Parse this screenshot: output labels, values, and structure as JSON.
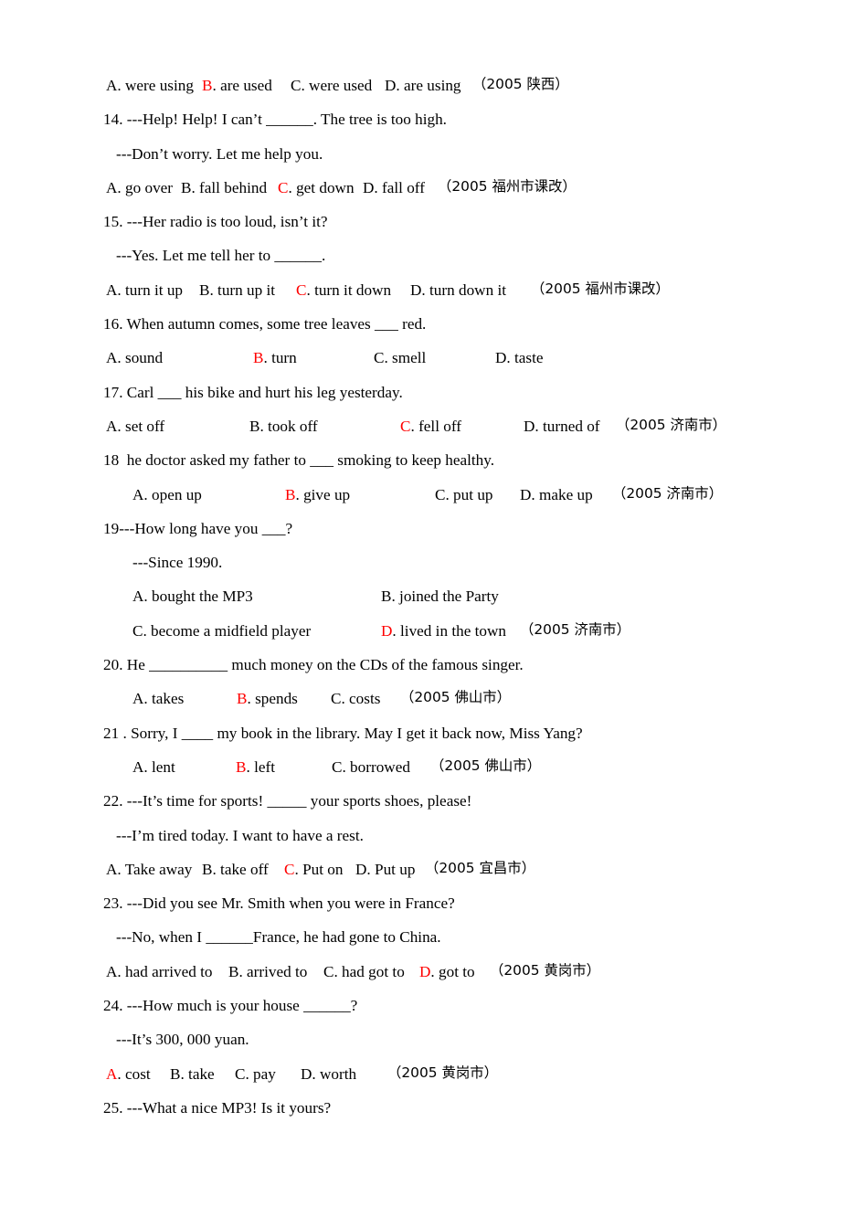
{
  "document": {
    "type": "english-grammar-multiple-choice-worksheet",
    "answer_color": "#ff0000",
    "text_color": "#000000",
    "background_color": "#ffffff"
  },
  "lines": {
    "q13_options": {
      "a": "A. were using",
      "b_letter": "B",
      "b_rest": ". are used",
      "c": "C. were used",
      "d": "D. are using",
      "source": "（2005 陕西）"
    },
    "q14": {
      "stem": "14. ---Help! Help! I can’t ______. The tree is too high.",
      "reply": "---Don’t worry. Let me help you.",
      "a": "A. go over",
      "b": "B. fall behind",
      "c_letter": "C",
      "c_rest": ". get down",
      "d": "D. fall off",
      "source": "（2005 福州市课改）"
    },
    "q15": {
      "stem": "15. ---Her radio is too loud, isn’t it?",
      "reply": "---Yes. Let me tell her to ______.",
      "a": "A. turn it up",
      "b": "B. turn up it",
      "c_letter": "C",
      "c_rest": ". turn it down",
      "d": "D. turn down it",
      "source": "（2005 福州市课改）"
    },
    "q16": {
      "stem": "16. When autumn comes, some tree leaves ___ red.",
      "a": "A. sound",
      "b_letter": "B",
      "b_rest": ". turn",
      "c": "C. smell",
      "d": "D. taste"
    },
    "q17": {
      "stem": "17. Carl ___ his bike and hurt his leg yesterday.",
      "a": "A. set off",
      "b": "B. took off",
      "c_letter": "C",
      "c_rest": ". fell off",
      "d": "D. turned of",
      "source": "（2005 济南市）"
    },
    "q18": {
      "stem": "18  he doctor asked my father to ___ smoking to keep healthy.",
      "a": "A. open up",
      "b_letter": "B",
      "b_rest": ". give up",
      "c": "C. put up",
      "d": "D. make up",
      "source": "（2005 济南市）"
    },
    "q19": {
      "stem": "19---How long have you ___?",
      "reply": "---Since 1990.",
      "a": "A. bought the MP3",
      "b": "B. joined the Party",
      "c": "C. become a midfield player",
      "d_letter": "D",
      "d_rest": ". lived in the town",
      "source": "（2005 济南市）"
    },
    "q20": {
      "stem": "20. He __________ much money on the CDs of the famous singer.",
      "a": "A. takes",
      "b_letter": "B",
      "b_rest": ". spends",
      "c": "C. costs",
      "source": "（2005 佛山市）"
    },
    "q21": {
      "stem": "21 . Sorry, I ____ my book in the library. May I get it back now, Miss Yang?",
      "a": "A. lent",
      "b_letter": "B",
      "b_rest": ". left",
      "c": "C. borrowed",
      "source": "（2005 佛山市）"
    },
    "q22": {
      "stem": "22. ---It’s time for sports! _____ your sports shoes, please!",
      "reply": "---I’m tired today. I want to have a rest.",
      "a": "A. Take away",
      "b": "B. take off",
      "c_letter": "C",
      "c_rest": ". Put on",
      "d": "D. Put up",
      "source": "（2005 宜昌市）"
    },
    "q23": {
      "stem": "23. ---Did you see Mr. Smith when you were in France?",
      "reply": "---No, when I ______France, he had gone to China.",
      "a": "A. had arrived to",
      "b": "B. arrived to",
      "c": "C. had got to",
      "d_letter": "D",
      "d_rest": ". got to",
      "source": "（2005 黄岗市）"
    },
    "q24": {
      "stem": "24. ---How much is your house ______?",
      "reply": "---It’s 300, 000 yuan.",
      "a_letter": "A",
      "a_rest": ". cost",
      "b": "B. take",
      "c": "C. pay",
      "d": "D. worth",
      "source": "（2005 黄岗市）"
    },
    "q25": {
      "stem": "25. ---What a nice MP3! Is it yours?"
    }
  }
}
